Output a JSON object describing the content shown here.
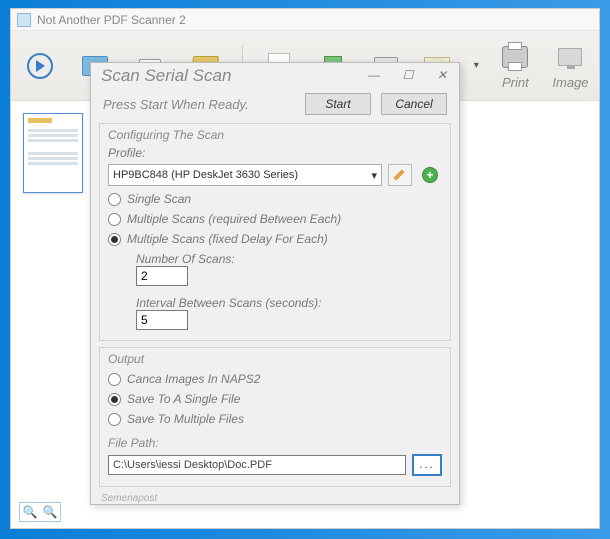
{
  "app": {
    "title": "Not Another PDF Scanner 2"
  },
  "toolbar": {
    "print_label": "Print",
    "image_label": "Image"
  },
  "dialog": {
    "title": "Scan Serial Scan",
    "prompt": "Press Start When Ready.",
    "start_button": "Start",
    "cancel_button": "Cancel",
    "config_group": {
      "title": "Configuring The Scan",
      "profile_label": "Profile:",
      "profile_value": "HP9BC848 (HP DeskJet 3630 Series)",
      "option_single": "Single Scan",
      "option_multi_req": "Multiple Scans (required Between Each)",
      "option_multi_fixed": "Multiple Scans (fixed Delay For Each)",
      "num_scans_label": "Number Of Scans:",
      "num_scans_value": "2",
      "interval_label": "Interval Between Scans (seconds):",
      "interval_value": "5"
    },
    "output_group": {
      "title": "Output",
      "option_cancel_images": "Canca Images In NAPS2",
      "option_single_file": "Save To A Single File",
      "option_multi_files": "Save To Multiple Files",
      "file_path_label": "File Path:",
      "file_path_value": "C:\\Users\\iessi Desktop\\Doc.PDF"
    },
    "footer_text": "Semenapost"
  }
}
